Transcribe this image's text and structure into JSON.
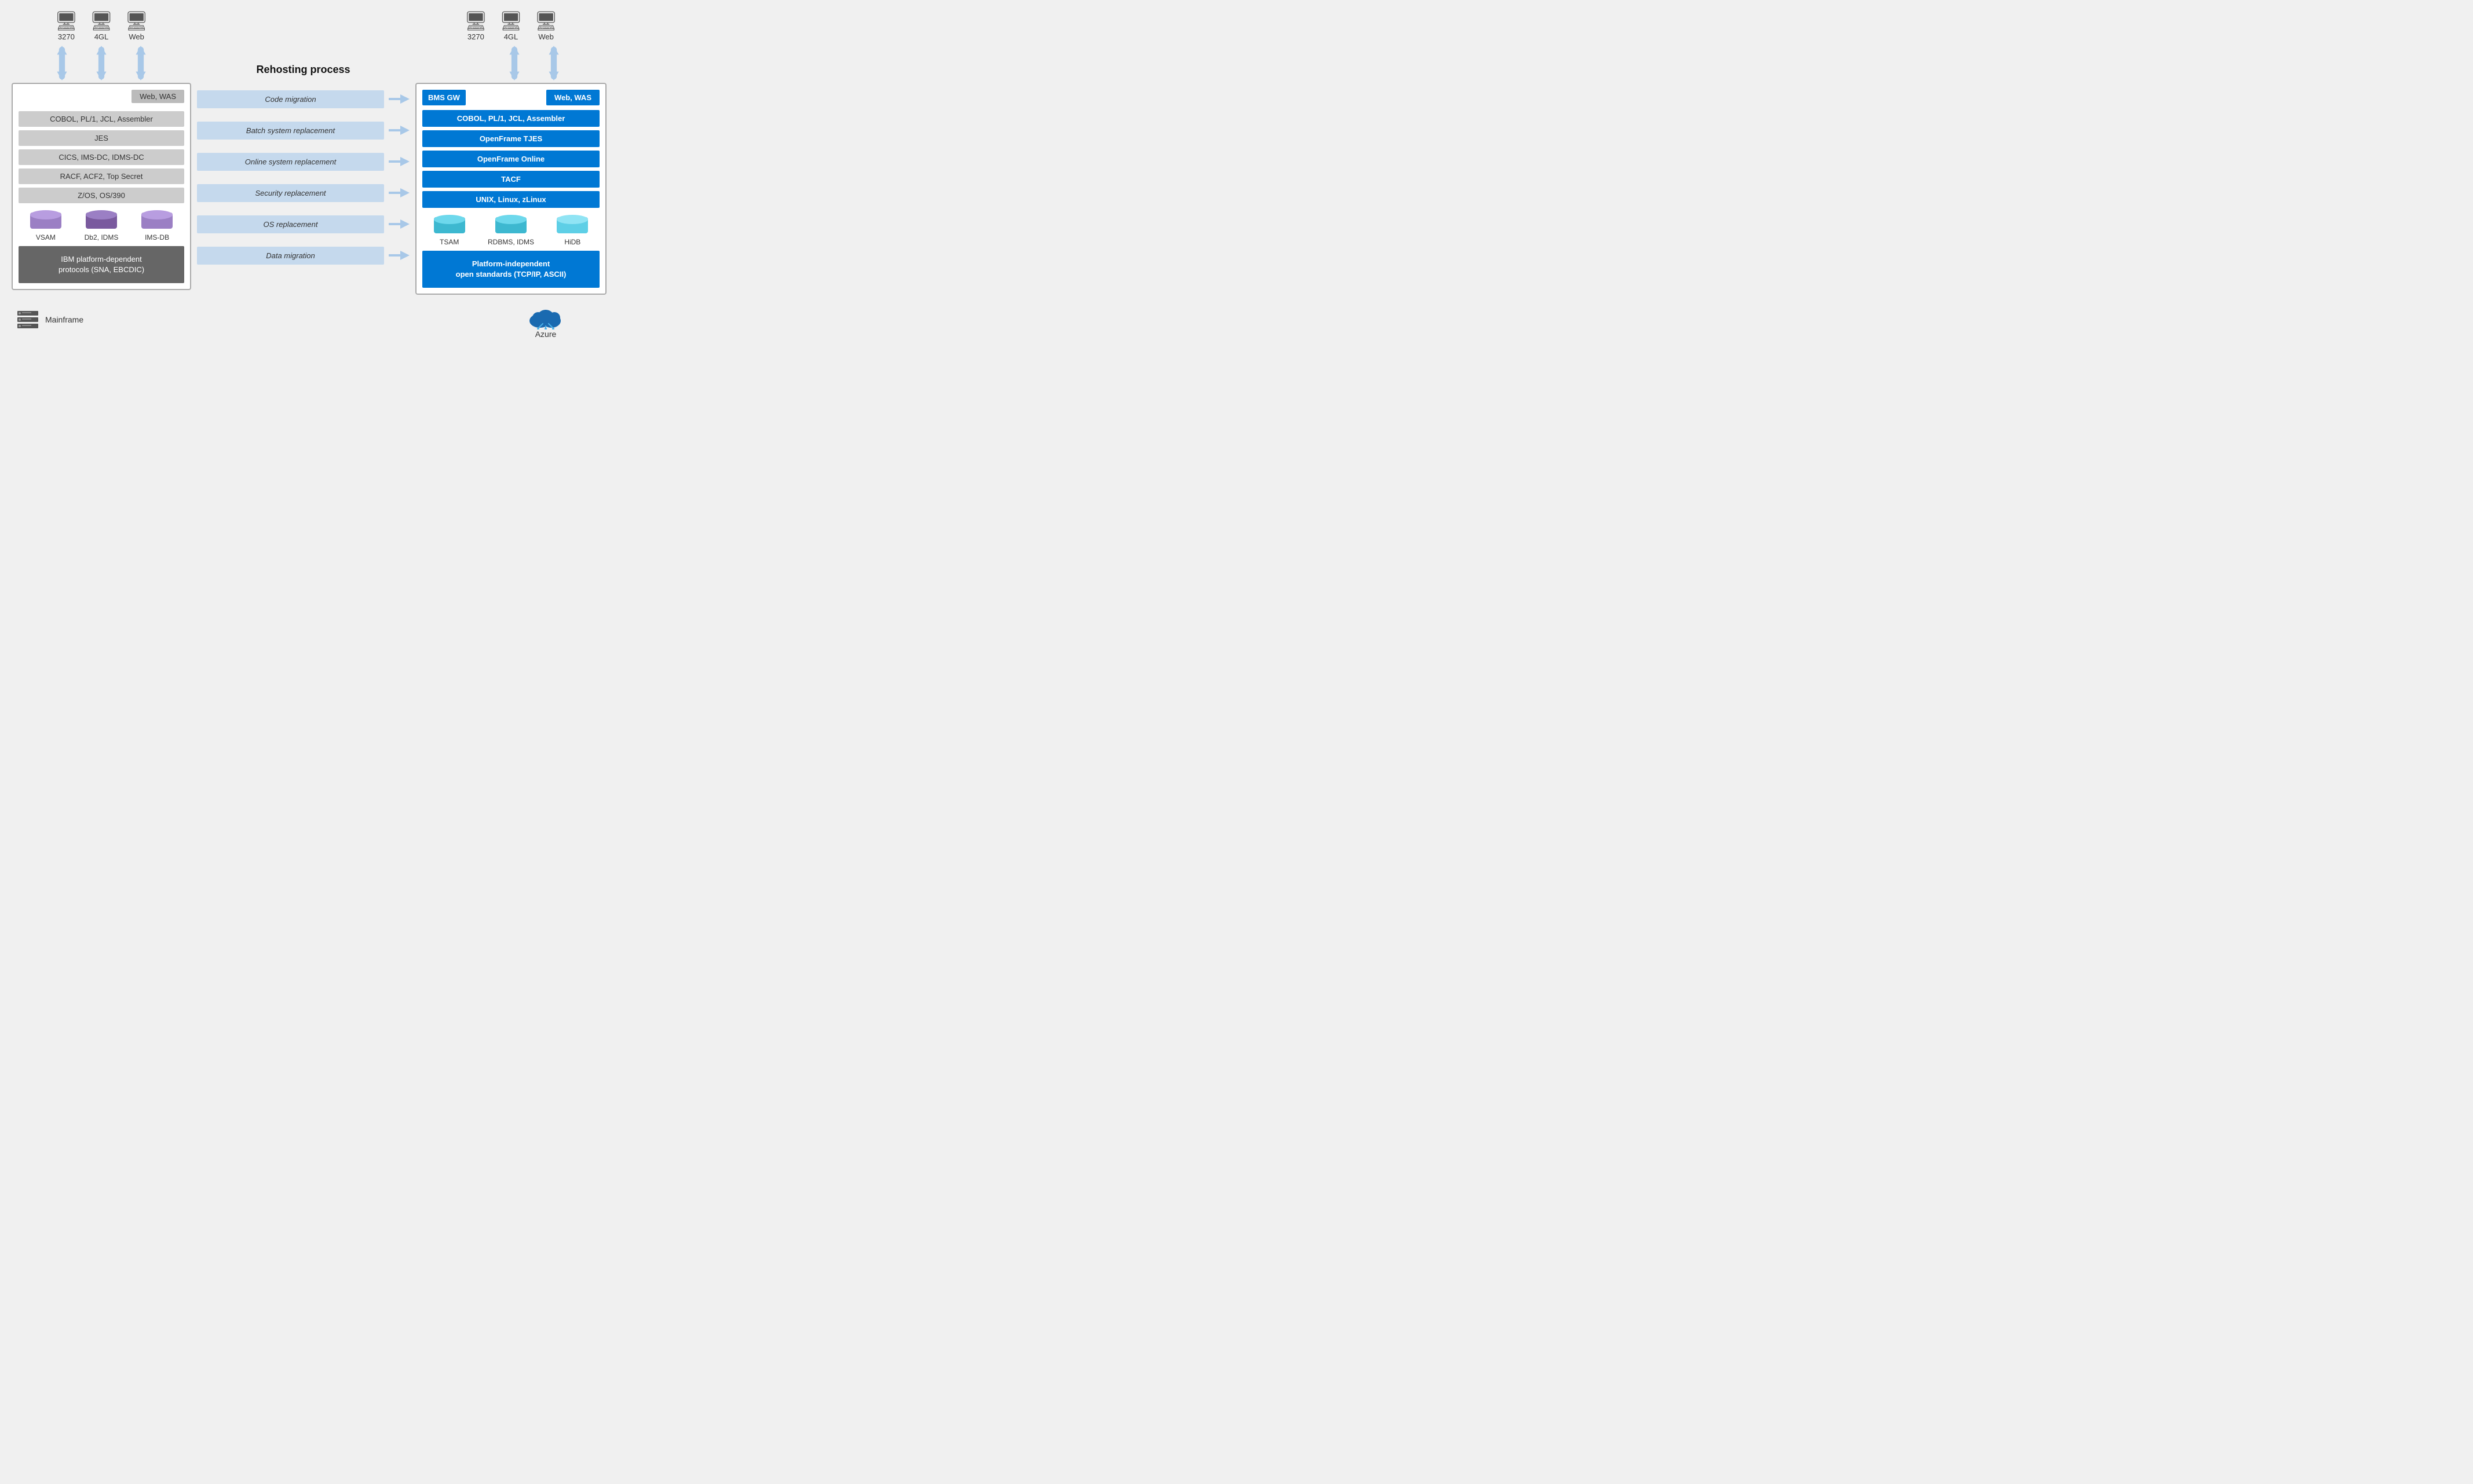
{
  "title": "Rehosting process",
  "left": {
    "monitors": [
      {
        "label": "3270"
      },
      {
        "label": "4GL"
      },
      {
        "label": "Web"
      }
    ],
    "web_was": "Web, WAS",
    "bars": [
      "COBOL, PL/1, JCL, Assembler",
      "JES",
      "CICS, IMS-DC, IDMS-DC",
      "RACF, ACF2, Top Secret",
      "Z/OS, OS/390"
    ],
    "databases": [
      {
        "label": "VSAM",
        "type": "purple"
      },
      {
        "label": "Db2, IDMS",
        "type": "darkpurple"
      },
      {
        "label": "IMS-DB",
        "type": "purple"
      }
    ],
    "ibm_box": "IBM platform-dependent\nprotocols (SNA, EBCDIC)"
  },
  "middle": {
    "title": "Rehosting process",
    "steps": [
      "Code migration",
      "Batch system replacement",
      "Online system replacement",
      "Security replacement",
      "OS replacement",
      "Data migration"
    ]
  },
  "right": {
    "monitors": [
      {
        "label": "3270"
      },
      {
        "label": "4GL"
      },
      {
        "label": "Web"
      }
    ],
    "bms_gw": "BMS GW",
    "web_was": "Web, WAS",
    "bars": [
      "COBOL, PL/1, JCL, Assembler",
      "OpenFrame TJES",
      "OpenFrame Online",
      "TACF",
      "UNIX, Linux, zLinux"
    ],
    "databases": [
      {
        "label": "TSAM",
        "type": "cyan"
      },
      {
        "label": "RDBMS, IDMS",
        "type": "cyan"
      },
      {
        "label": "HiDB",
        "type": "lightcyan"
      }
    ],
    "platform_box": "Platform-independent\nopen standards (TCP/IP, ASCII)"
  },
  "bottom": {
    "mainframe_label": "Mainframe",
    "azure_label": "Azure"
  }
}
